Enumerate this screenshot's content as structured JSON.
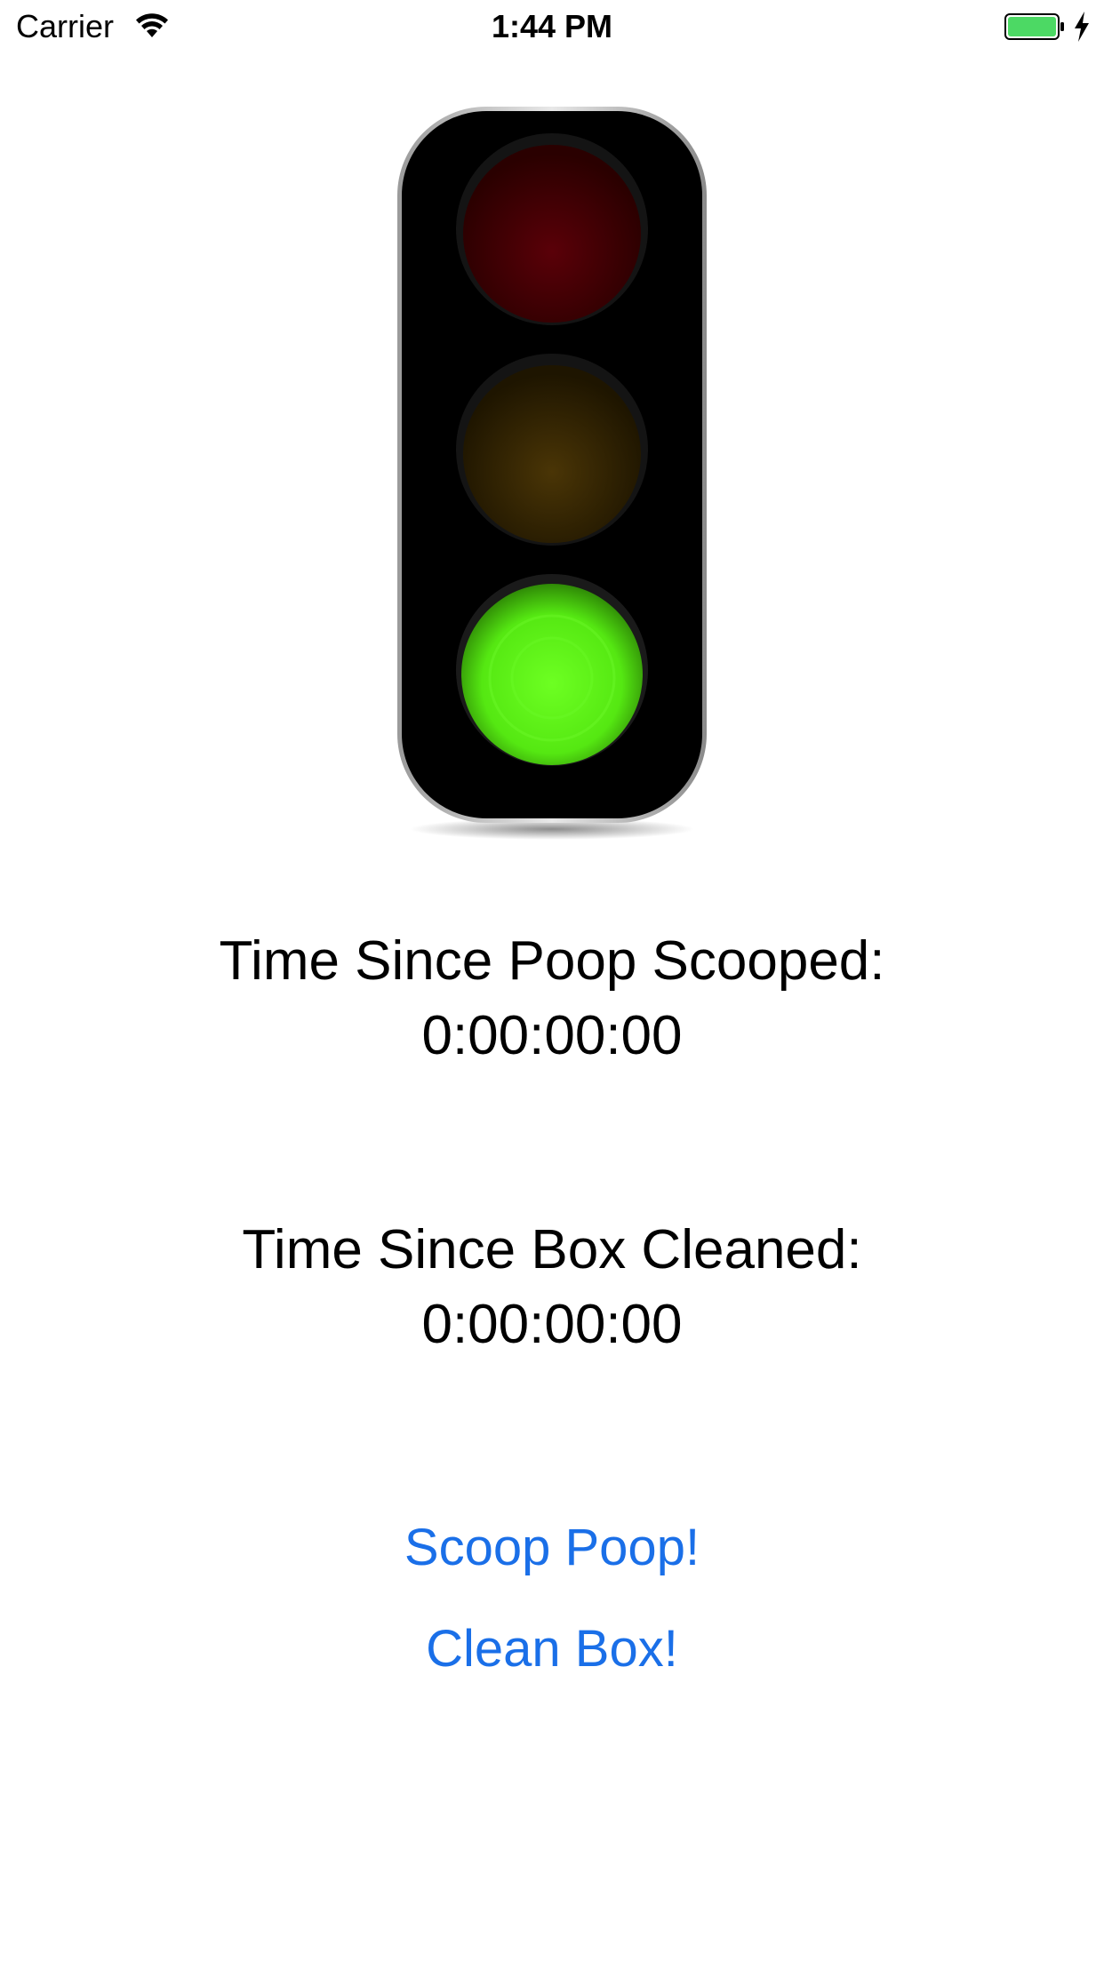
{
  "status_bar": {
    "carrier": "Carrier",
    "time": "1:44 PM",
    "wifi_icon": "wifi-icon",
    "battery_icon": "battery-icon",
    "charging_icon": "bolt-icon",
    "battery_color": "#4cd964"
  },
  "traffic_light": {
    "icon": "traffic-light-icon",
    "active_light": "green",
    "colors": {
      "red": "#4a0000",
      "yellow": "#3a2800",
      "green": "#5cf015"
    }
  },
  "timers": {
    "poop": {
      "label": "Time Since Poop Scooped:",
      "value": "0:00:00:00"
    },
    "box": {
      "label": "Time Since Box Cleaned:",
      "value": "0:00:00:00"
    }
  },
  "actions": {
    "scoop_label": "Scoop Poop!",
    "clean_label": "Clean Box!",
    "link_color": "#1a6fe8"
  }
}
